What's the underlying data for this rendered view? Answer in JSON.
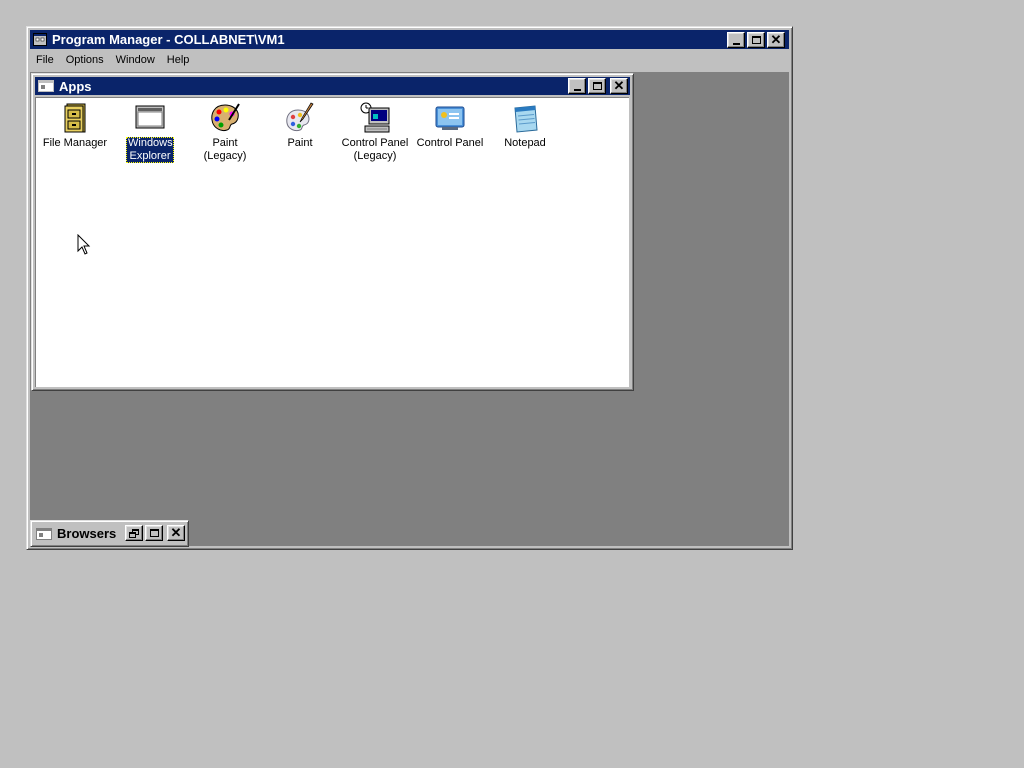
{
  "program_manager": {
    "title": "Program Manager - COLLABNET\\VM1",
    "menu": [
      "File",
      "Options",
      "Window",
      "Help"
    ]
  },
  "apps_window": {
    "title": "Apps",
    "icons": [
      {
        "label": "File Manager",
        "icon": "file-cabinet-icon",
        "selected": false
      },
      {
        "label": "Windows Explorer",
        "icon": "window-icon",
        "selected": true
      },
      {
        "label": "Paint (Legacy)",
        "icon": "palette-icon",
        "selected": false
      },
      {
        "label": "Paint",
        "icon": "paint-brush-icon",
        "selected": false
      },
      {
        "label": "Control Panel (Legacy)",
        "icon": "computer-control-icon",
        "selected": false
      },
      {
        "label": "Control Panel",
        "icon": "control-panel-icon",
        "selected": false
      },
      {
        "label": "Notepad",
        "icon": "notepad-icon",
        "selected": false
      }
    ]
  },
  "browsers_window": {
    "title": "Browsers",
    "state": "minimized"
  },
  "colors": {
    "active_title": "#0a246a",
    "desktop": "#c0c0c0",
    "mdi_background": "#808080",
    "selection": "#0a246a"
  }
}
